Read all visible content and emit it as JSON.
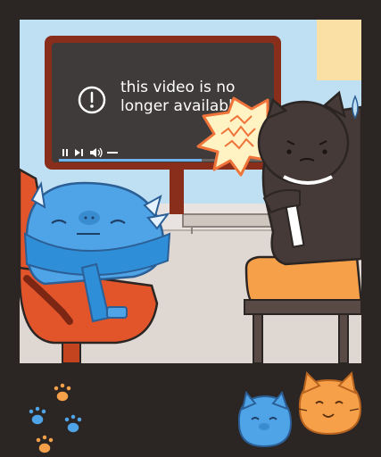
{
  "video": {
    "message_line1": "this video is no",
    "message_line2": "longer available"
  },
  "colors": {
    "frame": "#2b2523",
    "sky": "#bfe0f3",
    "screen": "#3f3b3a",
    "blue_cat": "#4fa4e8",
    "brown_cat": "#453a37",
    "orange": "#f6a04a",
    "chair_red": "#e2552b",
    "progress": "#6fb4ea"
  },
  "icons": [
    "alert-icon",
    "pause-icon",
    "next-icon",
    "volume-icon",
    "angry-burst-icon",
    "paw-print-icon",
    "blue-cat-sticker",
    "orange-cat-sticker"
  ]
}
